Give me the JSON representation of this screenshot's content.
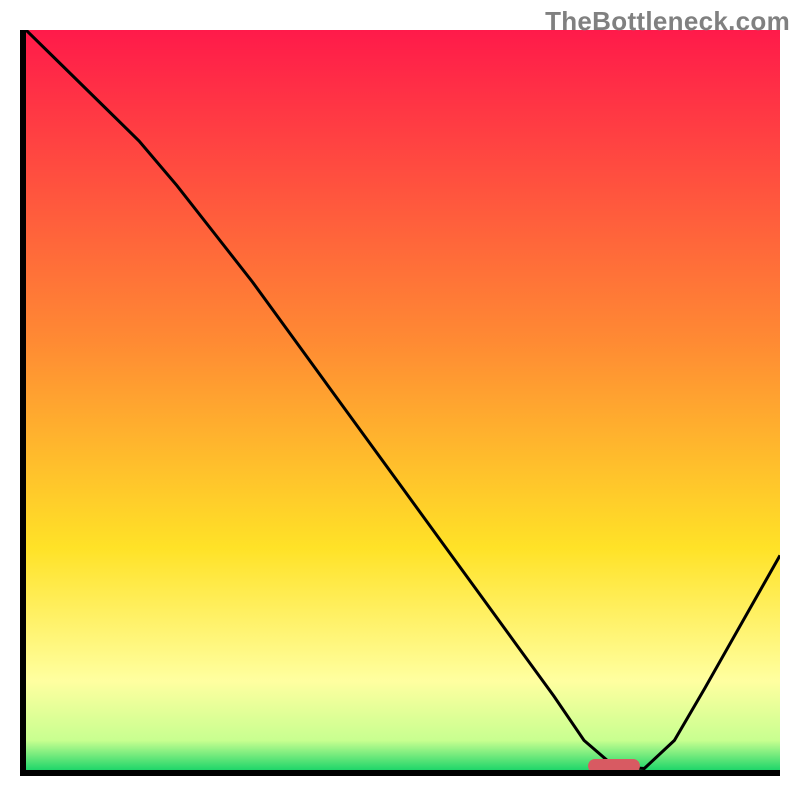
{
  "watermark": "TheBottleneck.com",
  "colors": {
    "red": "#ff1a4a",
    "orange": "#ff8a33",
    "yellow": "#ffe227",
    "pale_yellow": "#ffffa0",
    "green": "#1fd66a",
    "axis": "#000000",
    "curve": "#000000",
    "marker": "#d85a62"
  },
  "chart_data": {
    "type": "line",
    "title": "",
    "xlabel": "",
    "ylabel": "",
    "xlim": [
      0,
      100
    ],
    "ylim": [
      0,
      100
    ],
    "x": [
      0,
      5,
      10,
      15,
      20,
      25,
      30,
      35,
      40,
      45,
      50,
      55,
      60,
      65,
      70,
      74,
      78,
      82,
      86,
      90,
      95,
      100
    ],
    "values": [
      100,
      95,
      90,
      85,
      79,
      72.5,
      66,
      59,
      52,
      45,
      38,
      31,
      24,
      17,
      10,
      4,
      0.5,
      0.2,
      4,
      11,
      20,
      29
    ],
    "marker": {
      "x": 78,
      "y": 0.5
    },
    "gradient_stops": [
      {
        "offset": 0,
        "color": "#ff1a4a"
      },
      {
        "offset": 42,
        "color": "#ff8a33"
      },
      {
        "offset": 70,
        "color": "#ffe227"
      },
      {
        "offset": 88,
        "color": "#ffffa0"
      },
      {
        "offset": 96,
        "color": "#c8ff90"
      },
      {
        "offset": 100,
        "color": "#1fd66a"
      }
    ]
  }
}
